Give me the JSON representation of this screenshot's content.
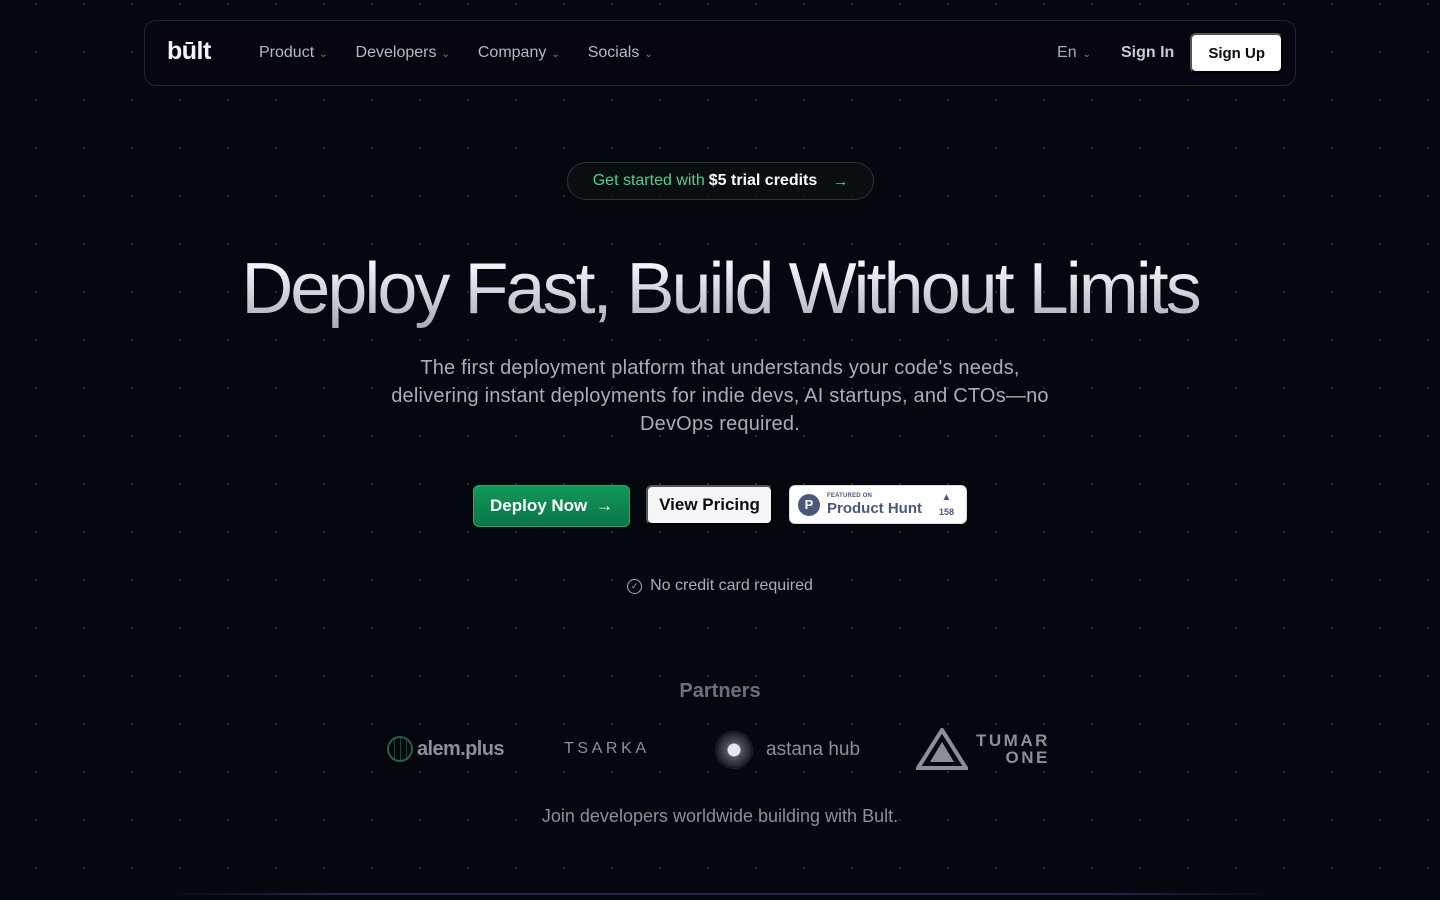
{
  "nav": {
    "logo": "būlt",
    "items": [
      {
        "label": "Product"
      },
      {
        "label": "Developers"
      },
      {
        "label": "Company"
      },
      {
        "label": "Socials"
      }
    ],
    "language": "En",
    "sign_in": "Sign In",
    "sign_up": "Sign Up"
  },
  "promo": {
    "prefix": "Get started with",
    "highlight": "$5 trial credits",
    "arrow_icon": "arrow-right-icon"
  },
  "hero": {
    "title": "Deploy Fast, Build Without Limits",
    "subtitle": "The first deployment platform that understands your code's needs, delivering instant deployments for indie devs, AI startups, and CTOs—no DevOps required."
  },
  "cta": {
    "deploy": "Deploy Now",
    "pricing": "View Pricing",
    "product_hunt": {
      "featured": "FEATURED ON",
      "name": "Product Hunt",
      "votes": "158"
    }
  },
  "no_credit": "No credit card required",
  "partners": {
    "title": "Partners",
    "logos": [
      {
        "name": "alem.plus"
      },
      {
        "name": "TSARKA"
      },
      {
        "name": "astana hub"
      },
      {
        "name": "TUMAR",
        "line2": "ONE"
      }
    ]
  },
  "join_text": "Join developers worldwide building with Bult.",
  "colors": {
    "background": "#05070f",
    "accent_green": "#12985a",
    "promo_text": "#4fd08d"
  }
}
